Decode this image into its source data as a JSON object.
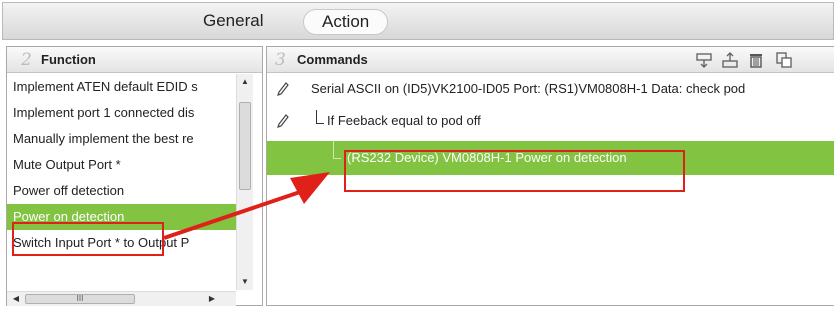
{
  "tabs": {
    "general": "General",
    "action": "Action"
  },
  "function_panel": {
    "number": "2",
    "title": "Function",
    "items": [
      "Implement ATEN default EDID s",
      "Implement port 1 connected dis",
      "Manually implement the best re",
      "Mute Output Port *",
      "Power off detection",
      "Power on detection",
      "Switch Input Port * to Output P"
    ],
    "selected_index": 5,
    "hscroll_grip": "III"
  },
  "commands_panel": {
    "number": "3",
    "title": "Commands",
    "toolbar_icons": [
      "import-icon",
      "export-icon",
      "delete-icon",
      "copy-icon"
    ],
    "rows": [
      "Serial ASCII  on (ID5)VK2100-ID05 Port: (RS1)VM0808H-1 Data: check pod",
      "If Feeback equal to pod off",
      "(RS232 Device) VM0808H-1 Power on detection"
    ],
    "selected_index": 2
  },
  "colors": {
    "selection_green": "#82c341",
    "annotation_red": "#e0211a"
  }
}
